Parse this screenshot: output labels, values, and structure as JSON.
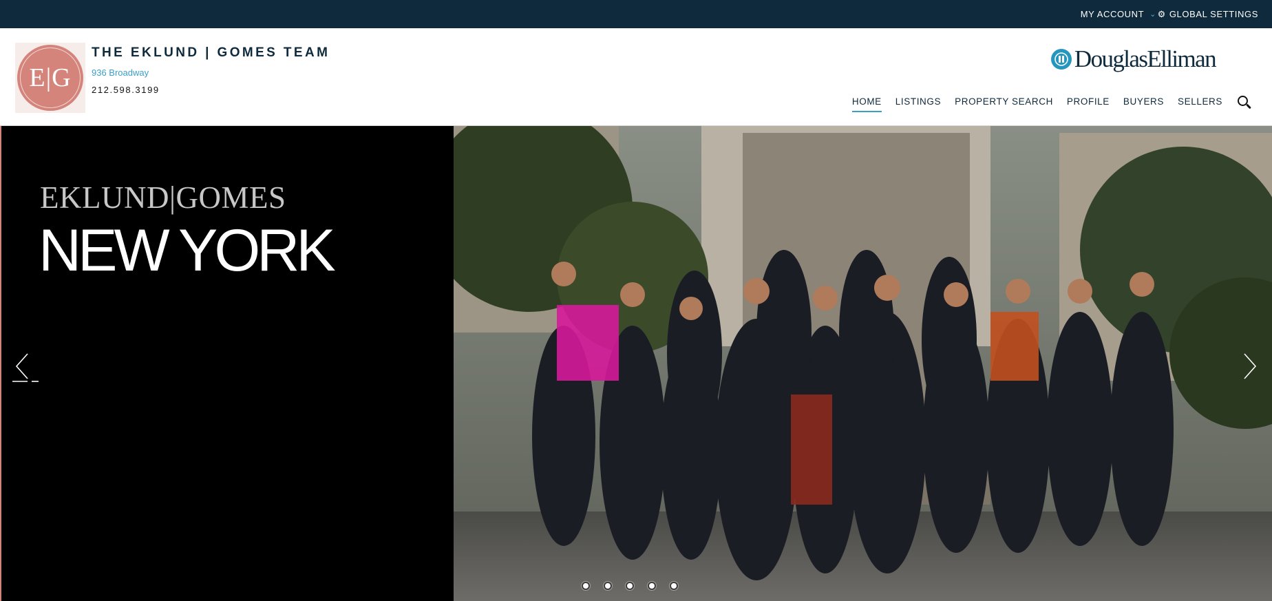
{
  "topbar": {
    "account_label": "MY ACCOUNT",
    "settings_label": "GLOBAL SETTINGS",
    "bg_color": "#0f2a3c",
    "accent_color": "#4fb3d9"
  },
  "header": {
    "logo_monogram": "E|G",
    "team_name": "THE EKLUND | GOMES TEAM",
    "address": "936 Broadway",
    "phone": "212.598.3199",
    "brand_name": "DouglasElliman",
    "logo_color": "#d4847b"
  },
  "nav": {
    "items": [
      {
        "label": "HOME",
        "active": true
      },
      {
        "label": "LISTINGS",
        "active": false
      },
      {
        "label": "PROPERTY SEARCH",
        "active": false
      },
      {
        "label": "PROFILE",
        "active": false
      },
      {
        "label": "BUYERS",
        "active": false
      },
      {
        "label": "SELLERS",
        "active": false
      }
    ],
    "search_icon": "search-icon"
  },
  "hero": {
    "kicker": "EKLUND|GOMES",
    "title": "NEW YORK",
    "photo": "team-group-photo",
    "slide_count": 5,
    "active_slide": 1
  },
  "icons": {
    "prev": "chevron-left-icon",
    "next": "chevron-right-icon",
    "gear": "gear-icon",
    "account_chevron": "chevron-down-icon"
  }
}
